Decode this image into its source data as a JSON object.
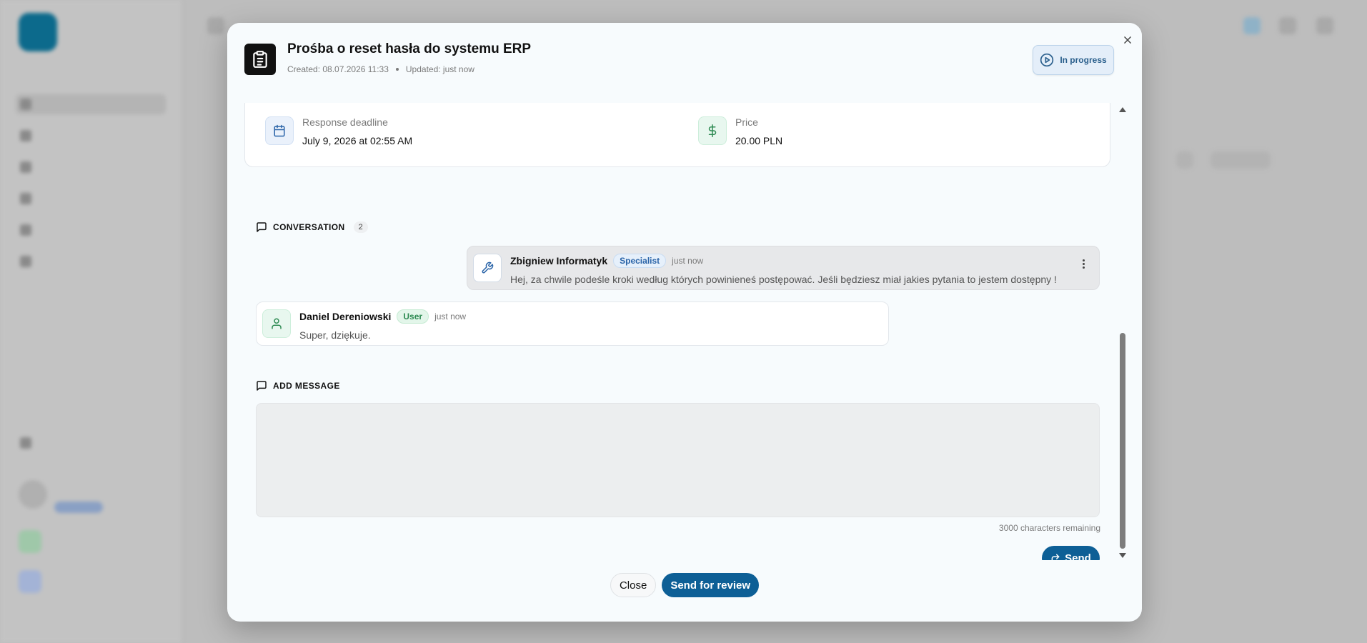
{
  "modal": {
    "title": "Prośba o reset hasła do systemu ERP",
    "created": "Created: 08.07.2026 11:33",
    "updated": "Updated: just now",
    "status": "In progress",
    "icons": {
      "header": "clipboard-list-icon",
      "status": "play-circle-icon",
      "close": "close-icon"
    }
  },
  "details": {
    "deadline_label": "Response deadline",
    "deadline_value": "July 9, 2026 at 02:55 AM",
    "price_label": "Price",
    "price_value": "20.00 PLN",
    "icons": {
      "deadline": "calendar-icon",
      "price": "dollar-icon"
    }
  },
  "conversation": {
    "heading": "CONVERSATION",
    "count": "2",
    "messages": [
      {
        "author": "Zbigniew Informatyk",
        "role": "Specialist",
        "time": "just now",
        "text": "Hej, za chwile podeśle kroki według których powinieneś postępować. Jeśli będziesz miał jakies pytania to jestem dostępny !",
        "icon": "wrench-icon"
      },
      {
        "author": "Daniel Dereniowski",
        "role": "User",
        "time": "just now",
        "text": "Super, dziękuje.",
        "icon": "user-icon"
      }
    ]
  },
  "composer": {
    "heading": "ADD MESSAGE",
    "value": "",
    "chars_remaining": "3000 characters remaining",
    "send_label": "Send"
  },
  "footer": {
    "close_label": "Close",
    "review_label": "Send for review"
  },
  "colors": {
    "primary": "#0d5f96",
    "status_bg": "#e4eef9",
    "specialist_badge": "#2a64a8",
    "user_badge": "#2d8a52"
  }
}
